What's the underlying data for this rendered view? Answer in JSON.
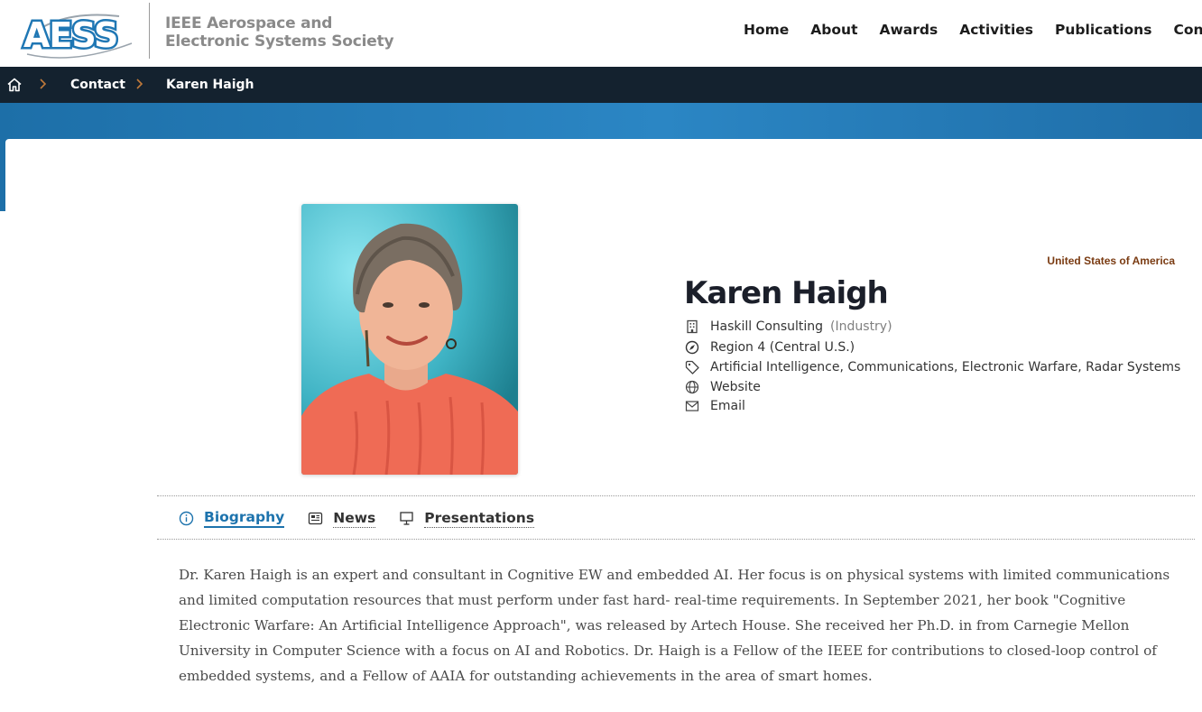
{
  "header": {
    "logo_text": "AESS",
    "society_line1": "IEEE Aerospace and",
    "society_line2": "Electronic Systems Society",
    "nav": [
      "Home",
      "About",
      "Awards",
      "Activities",
      "Publications",
      "Confere"
    ]
  },
  "breadcrumb": {
    "home_icon": "home-icon",
    "items": [
      "Contact",
      "Karen Haigh"
    ]
  },
  "profile": {
    "country": "United States of America",
    "name": "Karen Haigh",
    "company": "Haskill Consulting",
    "company_type": "(Industry)",
    "region": "Region 4 (Central U.S.)",
    "topics": "Artificial Intelligence, Communications, Electronic Warfare, Radar Systems",
    "website": "Website",
    "email": "Email"
  },
  "tabs": [
    {
      "label": "Biography",
      "icon": "info-icon",
      "active": true
    },
    {
      "label": "News",
      "icon": "newspaper-icon",
      "active": false
    },
    {
      "label": "Presentations",
      "icon": "presentation-icon",
      "active": false
    }
  ],
  "biography": "Dr. Karen Haigh is an expert and consultant in Cognitive EW and embedded AI. Her focus is on physical systems with limited communications and limited computation resources that must perform under fast hard- real-time requirements. In September 2021, her book \"Cognitive Electronic Warfare: An Artificial Intelligence Approach\", was released by Artech House. She received her Ph.D. in from Carnegie Mellon University in Computer Science with a focus on AI and Robotics. Dr. Haigh is a Fellow of the IEEE for contributions to closed-loop control of embedded systems, and a Fellow of AAIA for outstanding achievements in the area of smart homes.",
  "colors": {
    "accent_blue": "#1d73ad",
    "crumb_bg": "#14222f",
    "country": "#7a3b12"
  }
}
